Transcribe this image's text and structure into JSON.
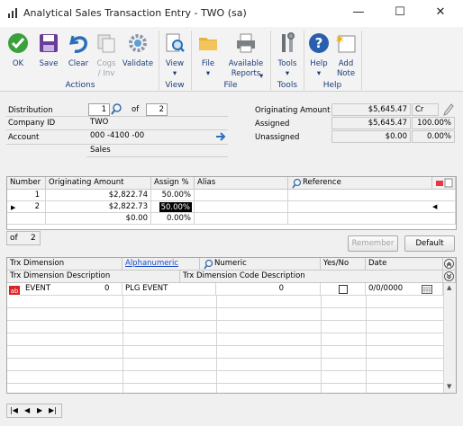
{
  "window": {
    "title": "Analytical Sales Transaction Entry  -  TWO (sa)"
  },
  "ribbon": {
    "ok": "OK",
    "save": "Save",
    "clear": "Clear",
    "cogs_line1": "Cogs",
    "cogs_line2": "/ Inv",
    "validate": "Validate",
    "view": "View",
    "file": "File",
    "available_line1": "Available",
    "available_line2": "Reports",
    "tools": "Tools",
    "help": "Help",
    "add_note_line1": "Add",
    "add_note_line2": "Note",
    "groups": {
      "actions": "Actions",
      "view": "View",
      "file": "File",
      "tools": "Tools",
      "help": "Help"
    }
  },
  "form": {
    "distribution_label": "Distribution",
    "distribution_value": "1",
    "of_label": "of",
    "distribution_total": "2",
    "company_label": "Company ID",
    "company_value": "TWO",
    "account_label": "Account",
    "account_value": "000 -4100 -00",
    "account_desc": "Sales",
    "orig_amount_label": "Originating Amount",
    "orig_amount_value": "$5,645.47",
    "currency": "Cr",
    "assigned_label": "Assigned",
    "assigned_value": "$5,645.47",
    "assigned_pct": "100.00%",
    "unassigned_label": "Unassigned",
    "unassigned_value": "$0.00",
    "unassigned_pct": "0.00%"
  },
  "grid1": {
    "headers": [
      "Number",
      "Originating Amount",
      "Assign %",
      "Alias",
      "Reference"
    ],
    "rows": [
      {
        "number": "1",
        "amount": "$2,822.74",
        "pct": "50.00%"
      },
      {
        "number": "2",
        "amount": "$2,822.73",
        "pct": "50.00%"
      },
      {
        "number": "",
        "amount": "$0.00",
        "pct": "0.00%"
      }
    ],
    "of_label": "of",
    "of_value": "2",
    "remember_button": "Remember",
    "default_button": "Default"
  },
  "grid2": {
    "headers_row1": [
      "Trx Dimension",
      "Alphanumeric",
      "Numeric",
      "Yes/No",
      "Date"
    ],
    "headers_row2": [
      "Trx Dimension Description",
      "Trx Dimension Code Description"
    ],
    "row": {
      "dimension": "EVENT",
      "num": "0",
      "alpha": "PLG EVENT",
      "numeric": "0",
      "date": "0/0/0000"
    }
  }
}
